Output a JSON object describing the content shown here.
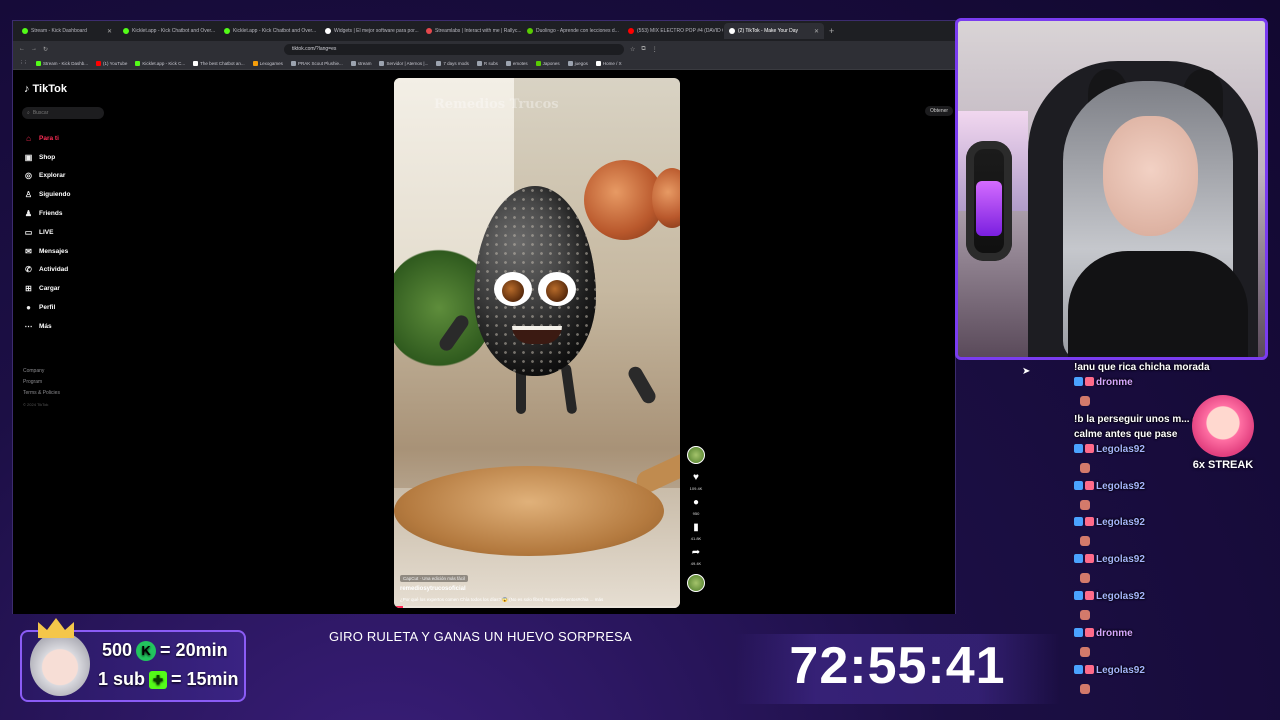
{
  "browser": {
    "tabs": [
      {
        "label": "Stream - Kick Dashboard",
        "color": "#53fc18"
      },
      {
        "label": "Kicklet.app - Kick Chatbot and Over...",
        "color": "#53fc18"
      },
      {
        "label": "Kicklet.app - Kick Chatbot and Over...",
        "color": "#53fc18"
      },
      {
        "label": "Widgets | El mejor software para por...",
        "color": "#ffffff"
      },
      {
        "label": "Streamlabs | Interact with me | Rallyc...",
        "color": "#e5484d"
      },
      {
        "label": "Duolingo - Aprende con lecciones d...",
        "color": "#58cc02"
      },
      {
        "label": "(553) MIX ELECTRO POP #4 (DAVID G...",
        "color": "#ff0000"
      },
      {
        "label": "(2) TikTok - Make Your Day",
        "color": "#ffffff"
      }
    ],
    "url": "tiktok.com/?lang=es",
    "bookmarks": [
      {
        "label": "Stream - Kick Dashb...",
        "color": "#53fc18"
      },
      {
        "label": "(1) YouTube",
        "color": "#ff0000"
      },
      {
        "label": "Kicklet.app - Kick C...",
        "color": "#53fc18"
      },
      {
        "label": "The best Chatbot an...",
        "color": "#ffffff"
      },
      {
        "label": "Lexogames",
        "color": "#f59e0b"
      },
      {
        "label": "PRAK Scout Plushie...",
        "color": "#9ca3af"
      },
      {
        "label": "stream",
        "color": "#9ca3af"
      },
      {
        "label": "Servidor | Aternos |...",
        "color": "#9ca3af"
      },
      {
        "label": "7 days mods",
        "color": "#9ca3af"
      },
      {
        "label": "R subs",
        "color": "#9ca3af"
      },
      {
        "label": "emotes",
        "color": "#9ca3af"
      },
      {
        "label": "Japones",
        "color": "#58cc02"
      },
      {
        "label": "juegos",
        "color": "#9ca3af"
      },
      {
        "label": "Home / X",
        "color": "#ffffff"
      }
    ]
  },
  "tiktok": {
    "logo": "TikTok",
    "search_placeholder": "Buscar",
    "obtain": "Obtener",
    "nav": [
      {
        "label": "Para ti",
        "icon": "home-icon",
        "glyph": "⌂",
        "active": true
      },
      {
        "label": "Shop",
        "icon": "shop-icon",
        "glyph": "▣",
        "active": false
      },
      {
        "label": "Explorar",
        "icon": "compass-icon",
        "glyph": "◎",
        "active": false
      },
      {
        "label": "Siguiendo",
        "icon": "following-icon",
        "glyph": "♙",
        "active": false
      },
      {
        "label": "Friends",
        "icon": "friends-icon",
        "glyph": "♟",
        "active": false
      },
      {
        "label": "LIVE",
        "icon": "live-icon",
        "glyph": "▭",
        "active": false
      },
      {
        "label": "Mensajes",
        "icon": "messages-icon",
        "glyph": "✉",
        "active": false
      },
      {
        "label": "Actividad",
        "icon": "activity-icon",
        "glyph": "✆",
        "active": false
      },
      {
        "label": "Cargar",
        "icon": "upload-icon",
        "glyph": "⊞",
        "active": false
      },
      {
        "label": "Perfil",
        "icon": "profile-icon",
        "glyph": "●",
        "active": false
      },
      {
        "label": "Más",
        "icon": "more-icon",
        "glyph": "⋯",
        "active": false
      }
    ],
    "footer": [
      "Company",
      "Program",
      "Terms & Policies"
    ],
    "copyright": "© 2024 TikTok",
    "video": {
      "watermark": "Remedios Trucos",
      "capcut": "CapCut · Una edición más fácil",
      "username": "remediosytrucosoficial",
      "description": "¿Por qué los expertos comen Chía todos los días? 😱 (No es solo fibra) #superalimentos#chia ...",
      "more": "más",
      "progress": 0.03
    },
    "actions": {
      "likes": "109.4K",
      "comments": "950",
      "saves": "41.8K",
      "shares": "49.4K"
    }
  },
  "chat": {
    "messages": [
      {
        "type": "text",
        "text": "!anu que rica chicha morada"
      },
      {
        "type": "user",
        "user": "dronme",
        "color": "#d6a7ff"
      },
      {
        "type": "text",
        "text": "!b la perseguir unos m... e"
      },
      {
        "type": "text",
        "text": "calme antes que pase"
      },
      {
        "type": "user",
        "user": "Legolas92",
        "color": "#a5b4fc"
      },
      {
        "type": "user",
        "user": "Legolas92",
        "color": "#a5b4fc"
      },
      {
        "type": "user",
        "user": "Legolas92",
        "color": "#a5b4fc"
      },
      {
        "type": "user",
        "user": "Legolas92",
        "color": "#a5b4fc"
      },
      {
        "type": "user",
        "user": "Legolas92",
        "color": "#a5b4fc"
      },
      {
        "type": "user",
        "user": "dronme",
        "color": "#d6a7ff"
      },
      {
        "type": "user",
        "user": "Legolas92",
        "color": "#a5b4fc"
      }
    ],
    "streak": "6x STREAK"
  },
  "overlay": {
    "sub_line1_amount": "500",
    "sub_line1_value": "= 20min",
    "sub_line2_amount": "1 sub",
    "sub_line2_value": "= 15min",
    "ticker": "GIRO RULETA Y GANAS UN HUEVO SORPRESA",
    "timer": "72:55:41"
  }
}
